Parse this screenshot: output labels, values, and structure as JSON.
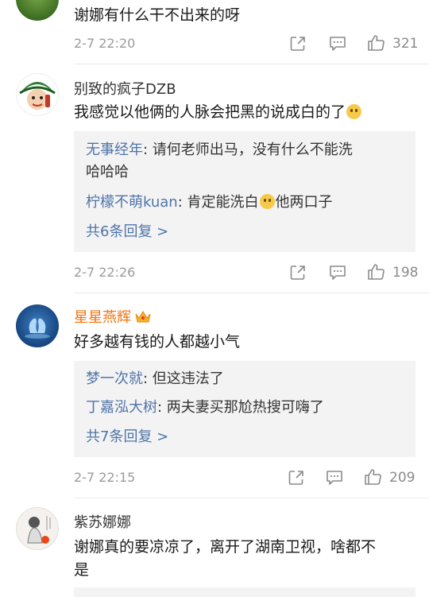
{
  "comments": [
    {
      "text": "谢娜有什么干不出来的呀",
      "time": "2-7 22:20",
      "likes": "321"
    },
    {
      "username": "别致的疯子DZB",
      "text": "我感觉以他俩的人脉会把黑的说成白的了",
      "emoji": "smile-emoji",
      "replies": [
        {
          "name": "无事经年",
          "text": ": 请何老师出马，没有什么不能洗",
          "text2": "哈哈哈"
        },
        {
          "name": "柠檬不萌kuan",
          "text": ": 肯定能洗白",
          "text_after": "他两口子"
        }
      ],
      "more": "共6条回复 >",
      "time": "2-7 22:26",
      "likes": "198"
    },
    {
      "username": "星星燕辉",
      "text": "好多越有钱的人都越小气",
      "replies": [
        {
          "name": "梦一次就",
          "text": ": 但这违法了"
        },
        {
          "name": "丁嘉泓大树",
          "text": ": 两夫妻买那尬热搜可嗨了"
        }
      ],
      "more": "共7条回复 >",
      "time": "2-7 22:15",
      "likes": "209"
    },
    {
      "username": "紫苏娜娜",
      "text": "谢娜真的要凉凉了，离开了湖南卫视，啥都不",
      "text2": "是"
    }
  ],
  "colors": {
    "link": "#4f74a8",
    "vip_name": "#f0720f",
    "meta": "#9b9b9b",
    "reply_bg": "#f3f3f4"
  },
  "icons": [
    "share-icon",
    "comment-icon",
    "like-icon",
    "crown-icon",
    "smile-emoji"
  ]
}
